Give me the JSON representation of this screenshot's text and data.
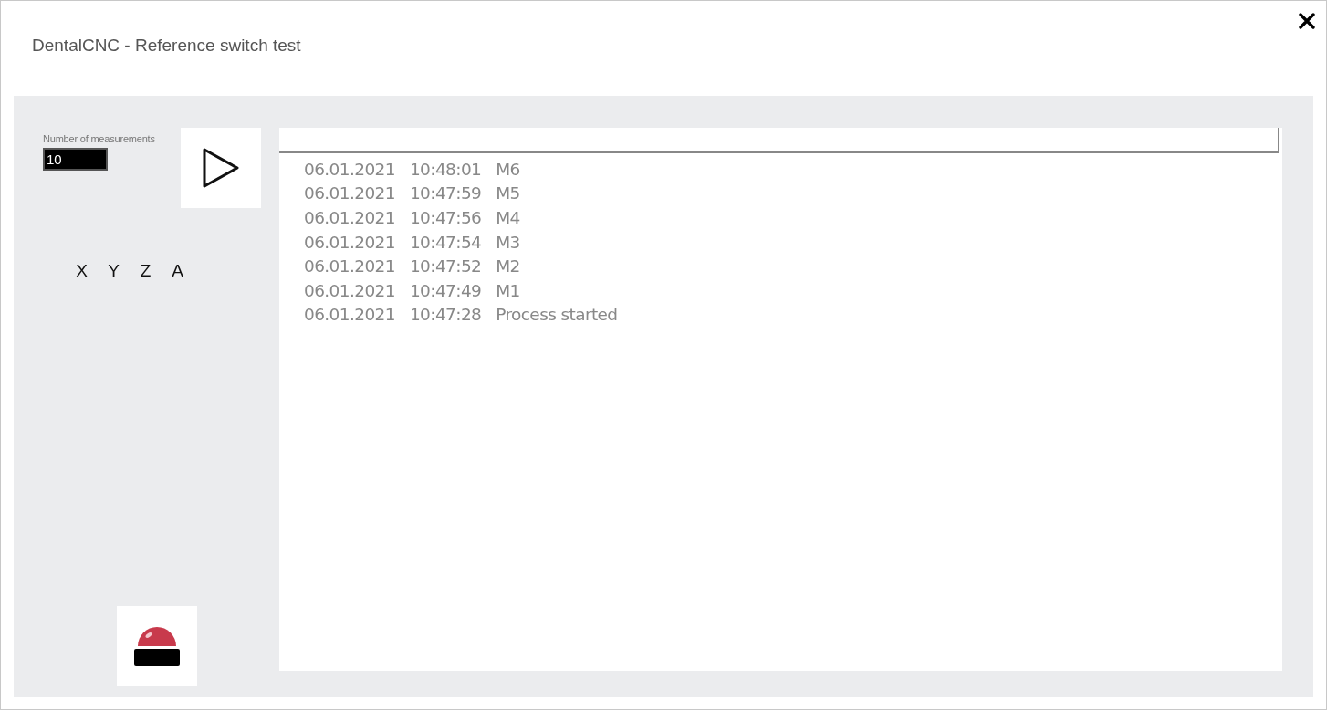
{
  "window": {
    "title": "DentalCNC - Reference switch test"
  },
  "measurements": {
    "label": "Number of measurements",
    "value": "10"
  },
  "axes": [
    "X",
    "Y",
    "Z",
    "A"
  ],
  "log": [
    {
      "date": "06.01.2021",
      "time": "10:48:01",
      "message": "M6"
    },
    {
      "date": "06.01.2021",
      "time": "10:47:59",
      "message": "M5"
    },
    {
      "date": "06.01.2021",
      "time": "10:47:56",
      "message": "M4"
    },
    {
      "date": "06.01.2021",
      "time": "10:47:54",
      "message": "M3"
    },
    {
      "date": "06.01.2021",
      "time": "10:47:52",
      "message": "M2"
    },
    {
      "date": "06.01.2021",
      "time": "10:47:49",
      "message": "M1"
    },
    {
      "date": "06.01.2021",
      "time": "10:47:28",
      "message": "Process started"
    }
  ]
}
